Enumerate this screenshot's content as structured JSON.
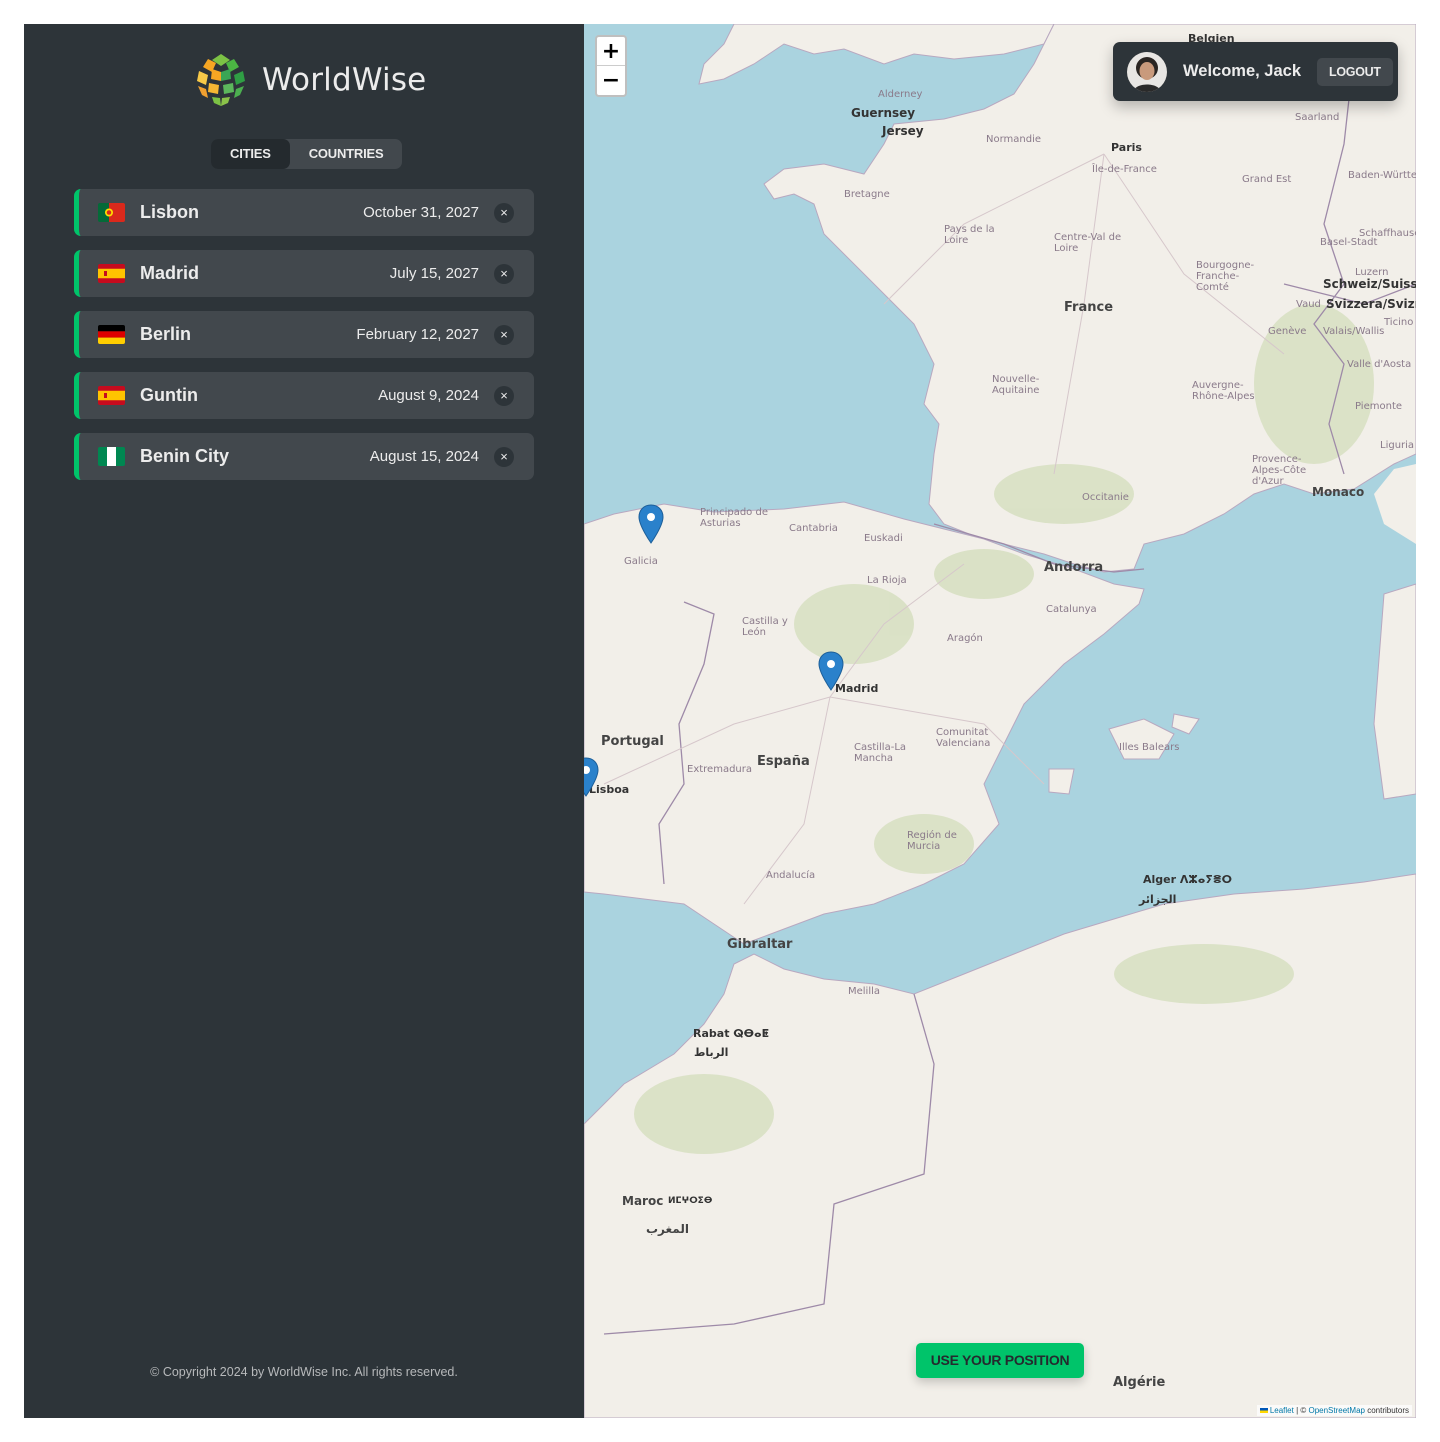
{
  "app": {
    "name": "WorldWise"
  },
  "tabs": [
    {
      "label": "CITIES",
      "active": true
    },
    {
      "label": "COUNTRIES",
      "active": false
    }
  ],
  "cities": [
    {
      "name": "Lisbon",
      "date": "October 31, 2027",
      "flag": "pt"
    },
    {
      "name": "Madrid",
      "date": "July 15, 2027",
      "flag": "es"
    },
    {
      "name": "Berlin",
      "date": "February 12, 2027",
      "flag": "de"
    },
    {
      "name": "Guntin",
      "date": "August 9, 2024",
      "flag": "es"
    },
    {
      "name": "Benin City",
      "date": "August 15, 2024",
      "flag": "ng"
    }
  ],
  "delete_symbol": "×",
  "footer": "© Copyright 2024 by WorldWise Inc. All rights reserved.",
  "user": {
    "welcome": "Welcome, Jack",
    "logout_label": "LOGOUT"
  },
  "map": {
    "zoom_in": "+",
    "zoom_out": "−",
    "position_button": "USE YOUR POSITION",
    "attribution": {
      "leaflet": "Leaflet",
      "separator": " | © ",
      "osm": "OpenStreetMap",
      "suffix": " contributors"
    },
    "labels": {
      "countries": [
        "France",
        "España",
        "Portugal",
        "Andorra",
        "Monaco",
        "Maroc",
        "Algérie",
        "Gibraltar",
        "Belgien",
        "Guernsey",
        "Jersey",
        "Schweiz/Suisse",
        "Svizzera/Svizra"
      ],
      "cities": [
        "Paris",
        "Madrid",
        "Lisboa",
        "Alger ⴷⵣⴰⵢⴻⵔ",
        "الجزائر",
        "Rabat ⵕⴱⴰⵟ",
        "الرباط",
        "المغرب",
        "ⵍⵎⵖⵔⵉⴱ",
        "Melilla"
      ],
      "regions": [
        "Normandie",
        "Île-de-France",
        "Bretagne",
        "Pays de la Loire",
        "Centre-Val de Loire",
        "Grand Est",
        "Bourgogne-Franche-Comté",
        "Nouvelle-Aquitaine",
        "Auvergne-Rhône-Alpes",
        "Occitanie",
        "Provence-Alpes-Côte d'Azur",
        "Galicia",
        "Principado de Asturias",
        "Cantabria",
        "Euskadi",
        "La Rioja",
        "Castilla y León",
        "Aragón",
        "Catalunya",
        "Extremadura",
        "Castilla-La Mancha",
        "Comunitat Valenciana",
        "Illes Balears",
        "Región de Murcia",
        "Andalucía",
        "Alderney",
        "Saarland",
        "Baden-Württemberg",
        "Basel-Stadt",
        "Luzern",
        "Vaud",
        "Genève",
        "Valais/Wallis",
        "Valle d'Aosta",
        "Piemonte",
        "Liguria",
        "Ticino",
        "Schaffhausen"
      ]
    },
    "markers": [
      "Guntin",
      "Madrid",
      "Lisbon"
    ],
    "colors": {
      "sea": "#aad3df",
      "land": "#f2efe9",
      "accent": "#00c46a",
      "marker": "#2a81cb"
    }
  }
}
